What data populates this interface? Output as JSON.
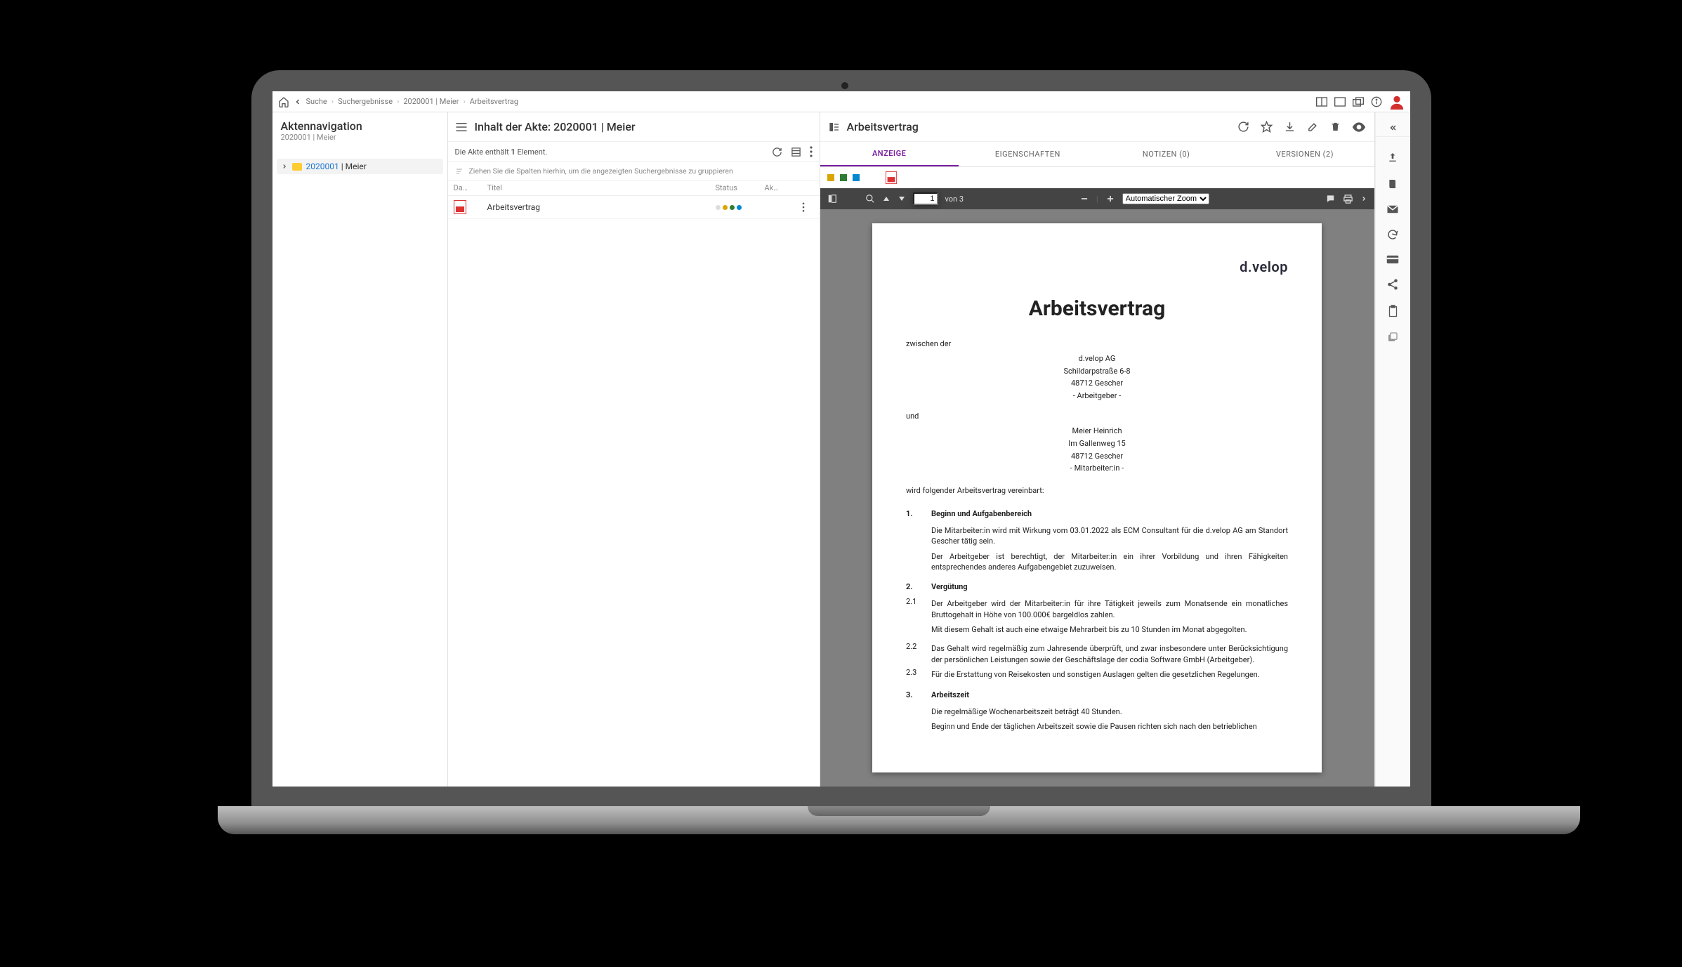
{
  "breadcrumb": [
    "Suche",
    "Suchergebnisse",
    "2020001 | Meier",
    "Arbeitsvertrag"
  ],
  "sidebar": {
    "title": "Aktennavigation",
    "subtitle": "2020001 | Meier",
    "tree": {
      "id": "2020001",
      "sep": " | ",
      "name": "Meier"
    }
  },
  "mid": {
    "title": "Inhalt der Akte: 2020001 | Meier",
    "count_pre": "Die Akte enthält ",
    "count_n": "1",
    "count_post": " Element.",
    "group_hint": "Ziehen Sie die Spalten hierhin, um die angezeigten Suchergebnisse zu gruppieren",
    "cols": {
      "c0": "Da…",
      "c1": "Titel",
      "c2": "Status",
      "c3": "Ak…"
    },
    "row": {
      "title": "Arbeitsvertrag"
    },
    "status_colors": [
      "#dddddd",
      "#d9a600",
      "#2e7d32",
      "#0288d1"
    ]
  },
  "doc": {
    "title": "Arbeitsvertrag",
    "tabs": {
      "anzeige": "ANZEIGE",
      "eigenschaften": "EIGENSCHAFTEN",
      "notizen": "NOTIZEN (0)",
      "versionen": "VERSIONEN (2)"
    },
    "tooltray_colors": [
      "#d9a600",
      "#2e7d32",
      "#0288d1"
    ],
    "pdfbar": {
      "page": "1",
      "of_pre": "von ",
      "total": "3",
      "zoom": "Automatischer Zoom"
    }
  },
  "page": {
    "brand": "d.velop",
    "heading": "Arbeitsvertrag",
    "zwischen": "zwischen der",
    "employer": [
      "d.velop AG",
      "Schildarpstraße 6-8",
      "48712 Gescher",
      "- Arbeitgeber -"
    ],
    "und": "und",
    "employee": [
      "Meier Heinrich",
      "Im Gallenweg 15",
      "48712 Gescher",
      "- Mitarbeiter:in -"
    ],
    "intro": "wird folgender Arbeitsvertrag vereinbart:",
    "s1": {
      "n": "1.",
      "h": "Beginn und Aufgabenbereich",
      "p1": "Die Mitarbeiter:in wird mit Wirkung vom 03.01.2022 als ECM Consultant für die d.velop AG am Standort Gescher tätig sein.",
      "p2": "Der Arbeitgeber ist berechtigt, der Mitarbeiter:in ein ihrer Vorbildung und ihren Fähigkeiten entsprechendes anderes Aufgabengebiet zuzuweisen."
    },
    "s2": {
      "n": "2.",
      "h": "Vergütung",
      "i21n": "2.1",
      "i21": "Der Arbeitgeber wird der Mitarbeiter:in für ihre Tätigkeit jeweils zum Monatsende ein monatliches Bruttogehalt in Höhe von 100.000€ bargeldlos zahlen.",
      "i21b": "Mit diesem Gehalt ist auch eine etwaige Mehrarbeit bis zu 10 Stunden im Monat abgegolten.",
      "i22n": "2.2",
      "i22": "Das Gehalt wird regelmäßig zum Jahresende überprüft, und zwar insbesondere unter Berücksichtigung der persönlichen Leistungen sowie der Geschäftslage der codia Software GmbH (Arbeitgeber).",
      "i23n": "2.3",
      "i23": "Für die Erstattung von Reisekosten und sonstigen Auslagen gelten die gesetzlichen Regelungen."
    },
    "s3": {
      "n": "3.",
      "h": "Arbeitszeit",
      "p1": "Die regelmäßige Wochenarbeitszeit beträgt 40 Stunden.",
      "p2": "Beginn und Ende der täglichen Arbeitszeit sowie die Pausen richten sich nach den betrieblichen"
    }
  }
}
